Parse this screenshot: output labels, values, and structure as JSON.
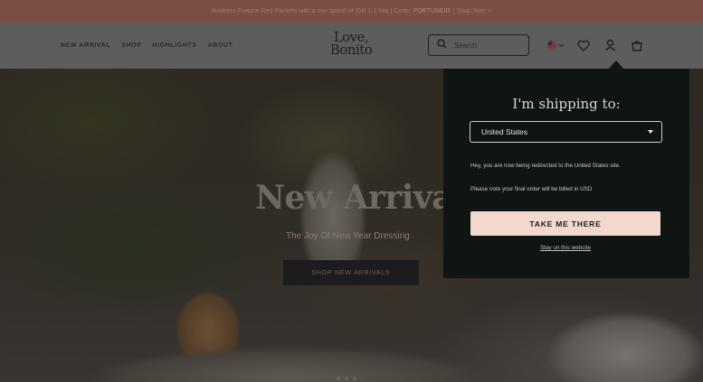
{
  "promo": {
    "text_before": "Redeem Fortune Red Packets with a min spend of IDR 1.2 Mio | Code:",
    "code": "FORTUNEID",
    "link": "| Shop Now >"
  },
  "nav": {
    "items": [
      "NEW ARRIVAL",
      "SHOP",
      "HIGHLIGHTS",
      "ABOUT"
    ]
  },
  "logo": {
    "line1": "Love,",
    "line2": "Bonito"
  },
  "search": {
    "placeholder": "Search"
  },
  "header_icons": [
    "flag-us-icon",
    "heart-icon",
    "account-icon",
    "bag-icon"
  ],
  "hero": {
    "title": "New Arrivals",
    "subtitle": "The Joy Of New Year Dressing",
    "cta": "SHOP NEW ARRIVALS",
    "slide_count": 3
  },
  "shipping": {
    "title": "I'm shipping to:",
    "selected_country": "United States",
    "message_redirect": "Hey, you are now being redirected to the United States site.",
    "message_billing": "Please note your final order will be billed in USD",
    "confirm_label": "TAKE ME THERE",
    "stay_label": "Stay on this website"
  },
  "colors": {
    "promo_bg": "#7a4f45",
    "panel_bg": "#0f1513",
    "button_bg": "#f3d9cd"
  }
}
